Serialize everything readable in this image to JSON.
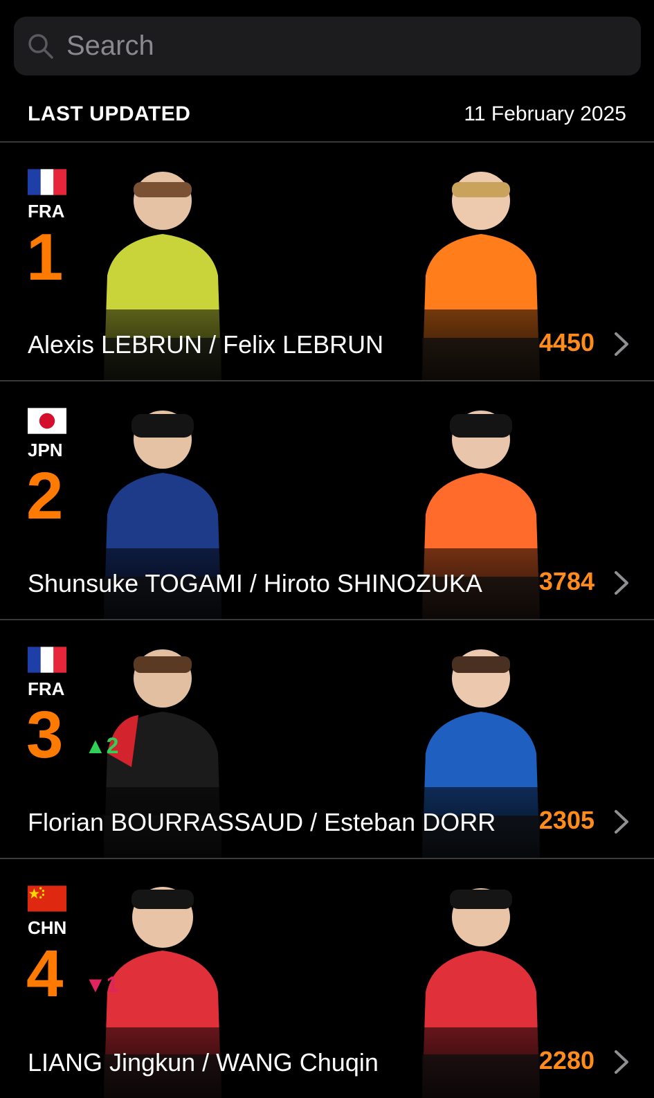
{
  "search": {
    "placeholder": "Search",
    "icon": "search-icon"
  },
  "header": {
    "title": "LAST UPDATED",
    "date": "11 February 2025"
  },
  "colors": {
    "rank": "#ff7a00",
    "points": "#ff8c1a",
    "up": "#30d158",
    "down": "#e0245e"
  },
  "rankings": [
    {
      "country": "FRA",
      "rank": "1",
      "change": "",
      "change_dir": "",
      "names": "Alexis LEBRUN / Felix LEBRUN",
      "points": "4450",
      "jersey_left": "#c9d43a",
      "jersey_right": "#ff7d1a"
    },
    {
      "country": "JPN",
      "rank": "2",
      "change": "",
      "change_dir": "",
      "names": "Shunsuke TOGAMI / Hiroto SHINOZUKA",
      "points": "3784",
      "jersey_left": "#1e3b8a",
      "jersey_right": "#ff6b2a"
    },
    {
      "country": "FRA",
      "rank": "3",
      "change": "▲2",
      "change_dir": "up",
      "names": "Florian BOURRASSAUD / Esteban DORR",
      "points": "2305",
      "jersey_left": "#1b1b1b",
      "jersey_right": "#1f5fbf"
    },
    {
      "country": "CHN",
      "rank": "4",
      "change": "▼1",
      "change_dir": "down",
      "names": "LIANG Jingkun / WANG Chuqin",
      "points": "2280",
      "jersey_left": "#e0303a",
      "jersey_right": "#e0303a"
    }
  ]
}
